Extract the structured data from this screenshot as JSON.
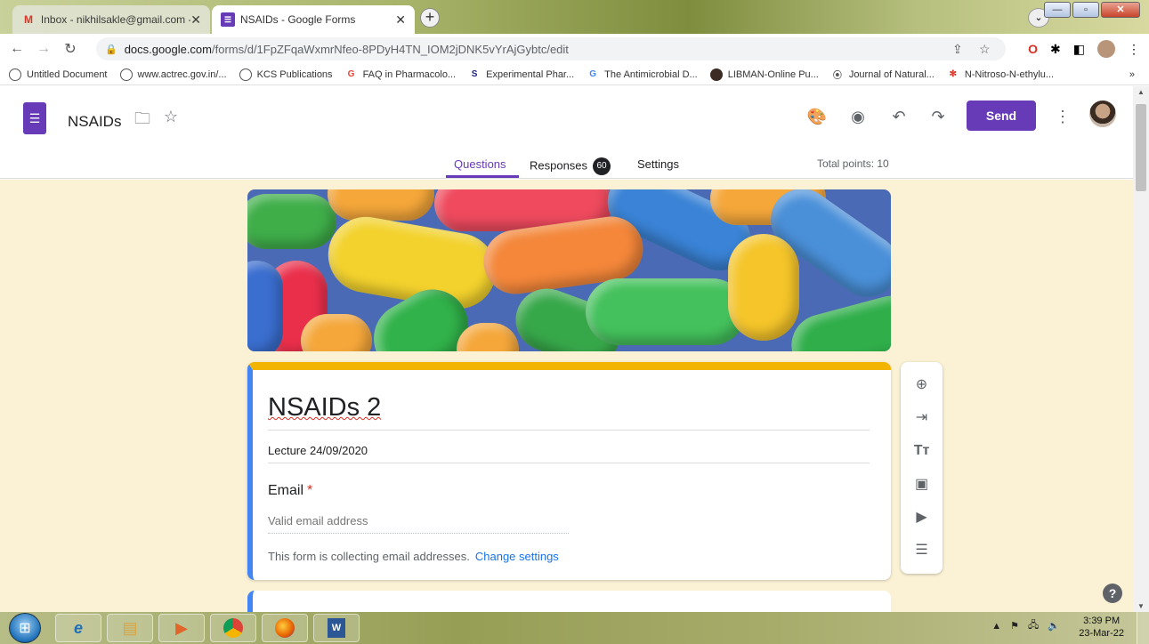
{
  "browser": {
    "tabs": [
      {
        "icon": "gmail-icon",
        "label": "Inbox - nikhilsakle@gmail.com -",
        "active": false
      },
      {
        "icon": "forms-icon",
        "label": "NSAIDs - Google Forms",
        "active": true
      }
    ],
    "url_host": "docs.google.com",
    "url_path": "/forms/d/1FpZFqaWxmrNfeo-8PDyH4TN_IOM2jDNK5vYrAjGybtc/edit",
    "bookmarks": [
      {
        "label": "Untitled Document",
        "icon": "globe-icon"
      },
      {
        "label": "www.actrec.gov.in/...",
        "icon": "globe-icon"
      },
      {
        "label": "KCS Publications",
        "icon": "globe-icon"
      },
      {
        "label": "FAQ in Pharmacolo...",
        "icon": "google-icon"
      },
      {
        "label": "Experimental Phar...",
        "icon": "springer-icon"
      },
      {
        "label": "The Antimicrobial D...",
        "icon": "google-icon"
      },
      {
        "label": "LIBMAN-Online Pu...",
        "icon": "libman-icon"
      },
      {
        "label": "Journal of Natural...",
        "icon": "journal-icon"
      },
      {
        "label": "N-Nitroso-N-ethylu...",
        "icon": "molecule-icon"
      }
    ],
    "bookmarks_more": "»"
  },
  "forms_header": {
    "title": "NSAIDs",
    "send_label": "Send",
    "tabs": {
      "questions": "Questions",
      "responses": "Responses",
      "responses_count": "60",
      "settings": "Settings"
    },
    "total_points": "Total points: 10"
  },
  "form": {
    "title": "NSAIDs 2",
    "description": "Lecture 24/09/2020",
    "email_label": "Email",
    "required_mark": "*",
    "email_placeholder": "Valid email address",
    "collecting_note": "This form is collecting email addresses.",
    "change_settings": "Change settings"
  },
  "colors": {
    "forms_purple": "#673ab7",
    "header_stripe": "#f2b400",
    "focus_blue": "#4285f4",
    "canvas_bg": "#fbf1d5",
    "link_blue": "#1a73e8"
  },
  "taskbar": {
    "time": "3:39 PM",
    "date": "23-Mar-22"
  }
}
